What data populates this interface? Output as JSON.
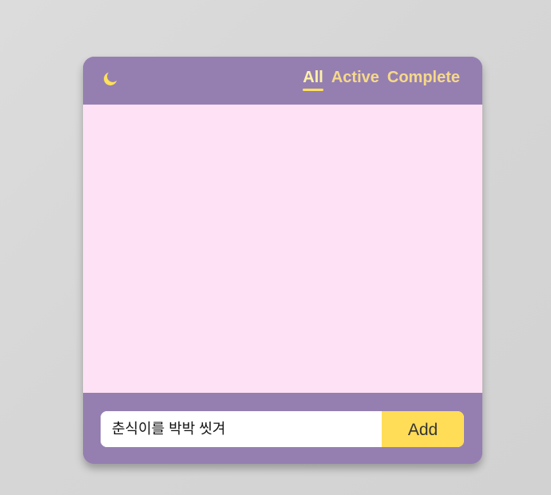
{
  "header": {
    "theme_toggle_icon": "moon-icon",
    "filters": [
      {
        "label": "All",
        "selected": true
      },
      {
        "label": "Active",
        "selected": false
      },
      {
        "label": "Complete",
        "selected": false
      }
    ]
  },
  "todo_list": {
    "items": []
  },
  "add_form": {
    "input_value": "춘식이를 박박 씻겨",
    "placeholder": "",
    "button_label": "Add"
  },
  "colors": {
    "page_background": "#d6d6d6",
    "card_purple": "#957fb1",
    "list_pink": "#ffe1f5",
    "accent_yellow": "#ffdd57",
    "tab_text": "#f6d98a"
  }
}
